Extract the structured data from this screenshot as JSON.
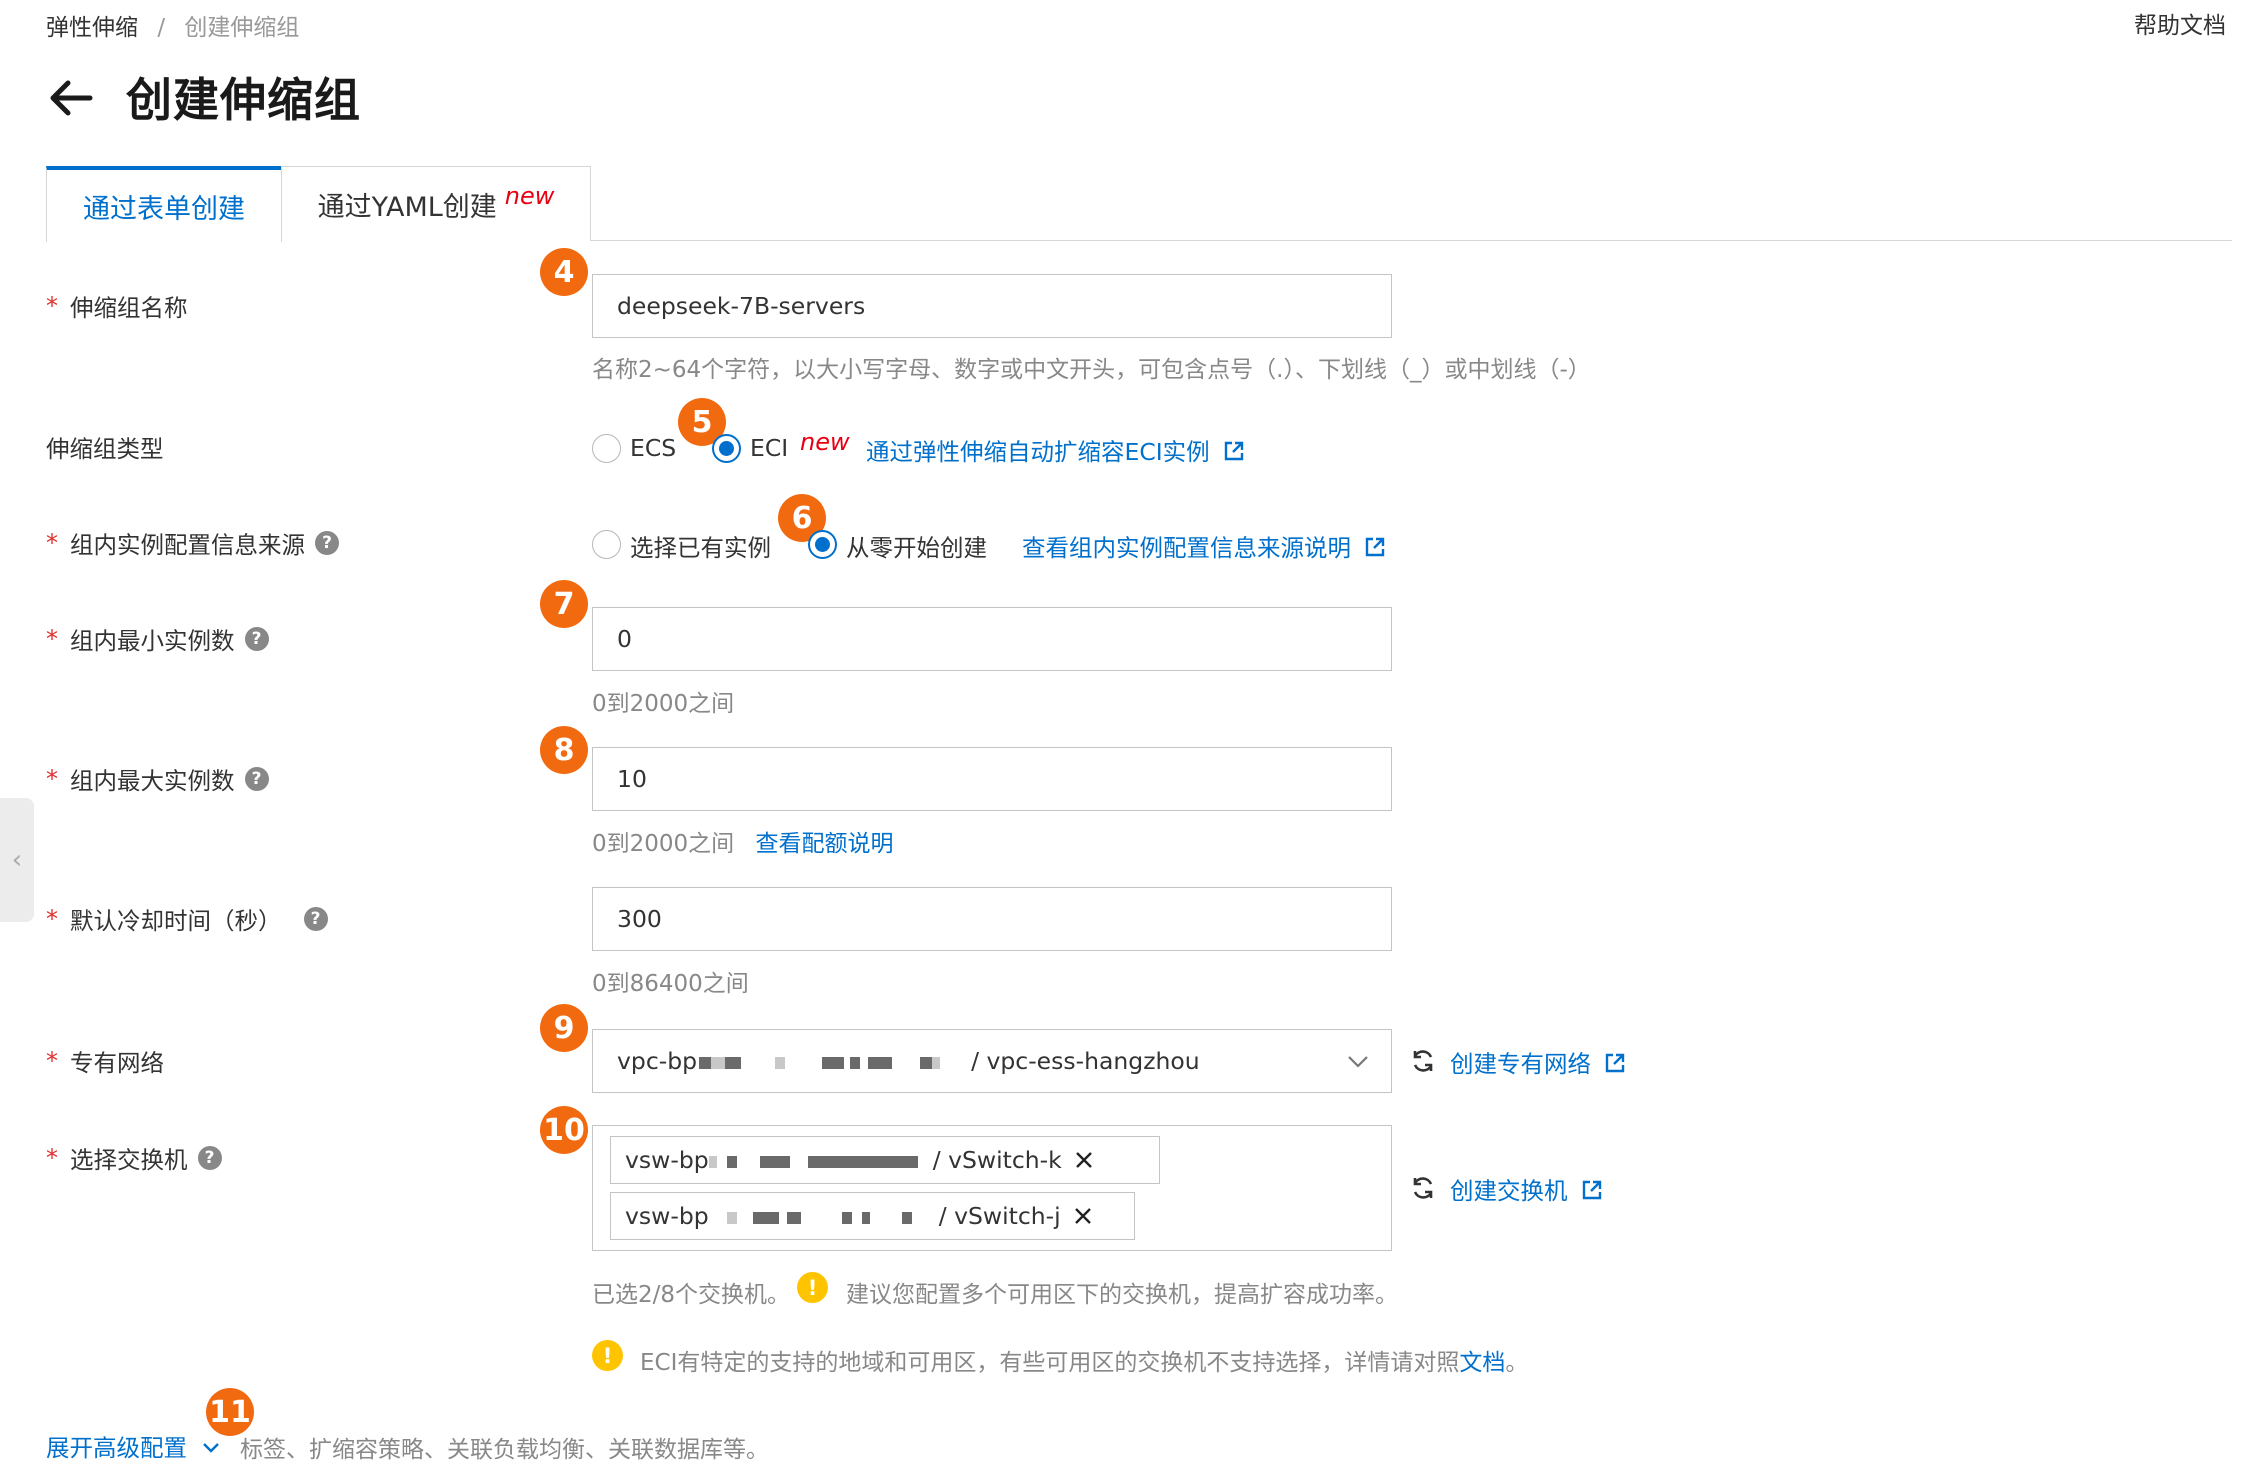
{
  "breadcrumb": {
    "root": "弹性伸缩",
    "separator": "/",
    "current": "创建伸缩组"
  },
  "header": {
    "help_link": "帮助文档",
    "title": "创建伸缩组"
  },
  "tabs": [
    {
      "label": "通过表单创建",
      "active": true
    },
    {
      "label": "通过YAML创建",
      "badge": "new",
      "active": false
    }
  ],
  "annotations": [
    "4",
    "5",
    "6",
    "7",
    "8",
    "9",
    "10",
    "11"
  ],
  "form": {
    "required_mark": "*",
    "help_glyph": "?",
    "name": {
      "label": "伸缩组名称",
      "value": "deepseek-7B-servers",
      "hint": "名称2~64个字符，以大小写字母、数字或中文开头，可包含点号（.）、下划线（_）或中划线（-）"
    },
    "type": {
      "label": "伸缩组类型",
      "options": [
        "ECS",
        "ECI"
      ],
      "selected": "ECI",
      "new_badge": "new",
      "link": "通过弹性伸缩自动扩缩容ECI实例"
    },
    "source": {
      "label": "组内实例配置信息来源",
      "options": [
        "选择已有实例",
        "从零开始创建"
      ],
      "selected": "从零开始创建",
      "link": "查看组内实例配置信息来源说明"
    },
    "min": {
      "label": "组内最小实例数",
      "value": "0",
      "hint": "0到2000之间"
    },
    "max": {
      "label": "组内最大实例数",
      "value": "10",
      "hint": "0到2000之间",
      "link": "查看配额说明"
    },
    "cooldown": {
      "label": "默认冷却时间（秒）",
      "value": "300",
      "hint": "0到86400之间"
    },
    "vpc": {
      "label": "专有网络",
      "value_prefix": "vpc-bp",
      "value_suffix": "/ vpc-ess-hangzhou",
      "create_link": "创建专有网络"
    },
    "vswitch": {
      "label": "选择交换机",
      "tags": [
        {
          "prefix": "vsw-bp",
          "suffix": "/ vSwitch-k"
        },
        {
          "prefix": "vsw-bp",
          "suffix": "/ vSwitch-j"
        }
      ],
      "create_link": "创建交换机",
      "selected_note": "已选2/8个交换机。",
      "suggestion": "建议您配置多个可用区下的交换机，提高扩容成功率。",
      "eci_note": "ECI有特定的支持的地域和可用区，有些可用区的交换机不支持选择，详情请对照",
      "eci_note_link": "文档",
      "eci_note_end": "。"
    }
  },
  "advanced": {
    "toggle": "展开高级配置",
    "description": "标签、扩缩容策略、关联负载均衡、关联数据库等。"
  },
  "colors": {
    "accent": "#0070cc",
    "badge": "#f26a10",
    "required": "#e03030",
    "warning": "#ffc400"
  },
  "icons": [
    "back-arrow-icon",
    "help-icon",
    "external-link-icon",
    "refresh-icon",
    "chevron-down-icon",
    "close-icon",
    "warning-icon",
    "chevron-left-icon"
  ]
}
